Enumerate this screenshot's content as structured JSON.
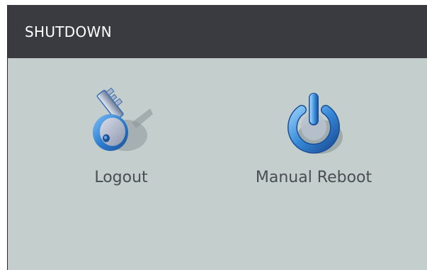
{
  "dialog": {
    "title": "SHUTDOWN"
  },
  "actions": [
    {
      "label": "Logout",
      "icon": "key-icon"
    },
    {
      "label": "Manual Reboot",
      "icon": "power-icon"
    }
  ],
  "colors": {
    "titlebar": "#3a3b40",
    "panel": "#c4cecc",
    "label_text": "#4a4d52",
    "icon_blue": "#3d8ad6"
  }
}
